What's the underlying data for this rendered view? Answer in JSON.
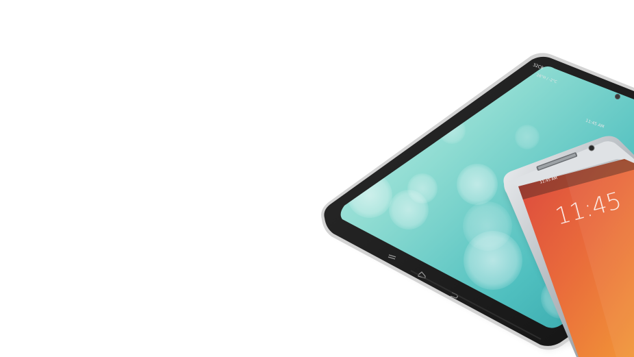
{
  "tablet": {
    "status_left": "32C8",
    "status_weather": "26°H / -2°C",
    "status_time": "11:45 AM",
    "wallpaper_colors": [
      "#9fe3d8",
      "#56c6c8",
      "#2fa3a6",
      "#7fd3b8"
    ]
  },
  "phone": {
    "status_time": "11:45 AM",
    "clock": "11:45",
    "wallpaper_colors": [
      "#e2504a",
      "#ee7a3a",
      "#f29a37"
    ]
  },
  "colors": {
    "tablet_body": "#1b1b1b",
    "tablet_rim": "#cfcfcf",
    "phone_rim": "#c9cdd1"
  }
}
